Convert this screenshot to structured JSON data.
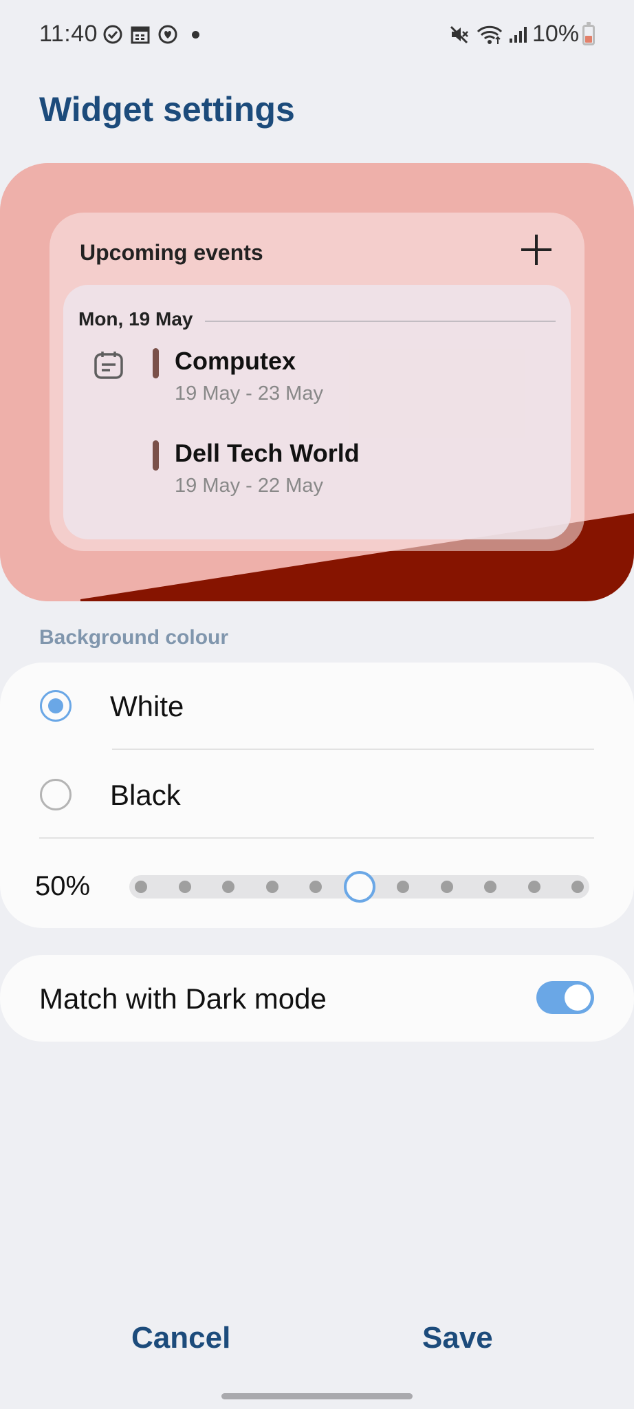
{
  "status_bar": {
    "time": "11:40",
    "battery_percent": "10%",
    "left_icons": [
      "check-circle-icon",
      "calendar-icon",
      "heart-badge-icon",
      "dot-icon"
    ],
    "right_icons": [
      "mute-icon",
      "wifi-icon",
      "signal-icon",
      "battery-icon"
    ]
  },
  "page": {
    "title": "Widget settings"
  },
  "preview": {
    "widget_title": "Upcoming events",
    "add_icon": "plus-icon",
    "date_header": "Mon, 19 May",
    "events": [
      {
        "name": "Computex",
        "dates": "19 May - 23 May"
      },
      {
        "name": "Dell Tech World",
        "dates": "19 May - 22 May"
      }
    ],
    "colors": {
      "wallpaper_light": "#eeb0aa",
      "wallpaper_dark": "#861400",
      "event_bar": "#7a5049"
    }
  },
  "background": {
    "section_label": "Background colour",
    "options": [
      {
        "label": "White",
        "selected": true
      },
      {
        "label": "Black",
        "selected": false
      }
    ],
    "transparency_label": "50%",
    "transparency_fraction": 0.5,
    "slider_steps": 11
  },
  "dark_mode": {
    "label": "Match with Dark mode",
    "enabled": true
  },
  "footer": {
    "cancel_label": "Cancel",
    "save_label": "Save"
  },
  "colors": {
    "accent": "#6aa7e6",
    "title": "#1c4b7b",
    "section_header": "#8096ad"
  }
}
